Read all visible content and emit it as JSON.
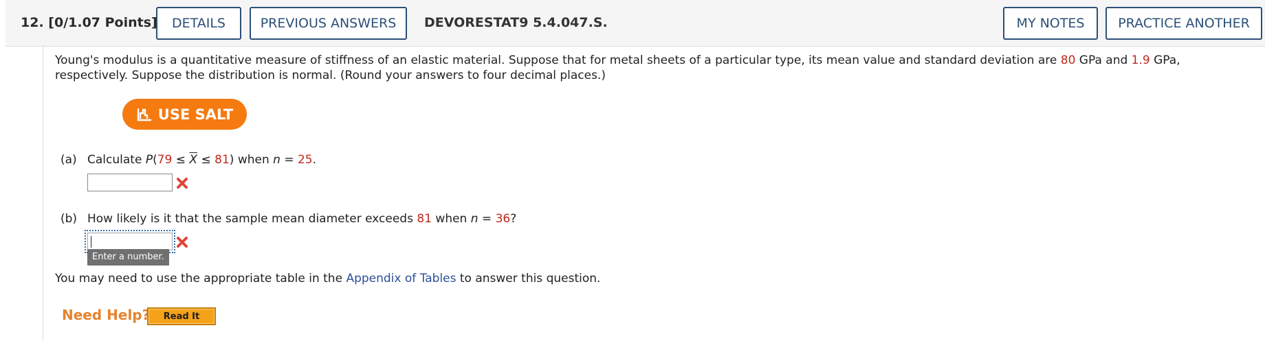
{
  "header": {
    "question_number": "12.",
    "points": "[0/1.07 Points]",
    "details_label": "DETAILS",
    "previous_answers_label": "PREVIOUS ANSWERS",
    "question_code": "DEVORESTAT9 5.4.047.S.",
    "my_notes_label": "MY NOTES",
    "practice_another_label": "PRACTICE ANOTHER"
  },
  "problem": {
    "text_1": "Young's modulus is a quantitative measure of stiffness of an elastic material. Suppose that for metal sheets of a particular type, its mean value and standard deviation are ",
    "mean": "80",
    "text_2": " GPa and ",
    "sd": "1.9",
    "text_3": " GPa, respectively. Suppose the distribution is normal. (Round your answers to four decimal places.)"
  },
  "salt": {
    "label": "USE SALT"
  },
  "part_a": {
    "label": "(a)",
    "text_1": "Calculate ",
    "p": "P",
    "lower": "79",
    "le1": " ≤ ",
    "xbar": "X",
    "le2": " ≤ ",
    "upper": "81",
    "text_2": ") when ",
    "n_var": "n",
    "eq": " = ",
    "n": "25",
    "end": "."
  },
  "part_b": {
    "label": "(b)",
    "text_1": "How likely is it that the sample mean diameter exceeds ",
    "value": "81",
    "text_2": " when ",
    "n_var": "n",
    "eq": " = ",
    "n": "36",
    "end": "?",
    "tooltip": "Enter a number."
  },
  "appendix": {
    "text_1": "You may need to use the appropriate table in the ",
    "link": "Appendix of Tables",
    "text_2": " to answer this question."
  },
  "help": {
    "need_help": "Need Help?",
    "read_it": "Read It"
  },
  "colors": {
    "accent_red": "#c0281e",
    "salt_orange": "#f57a10",
    "button_border": "#2c4f77",
    "wrong_mark": "#e0453a"
  },
  "icons": {
    "salt": "salt-chart-icon",
    "incorrect": "x-icon"
  }
}
